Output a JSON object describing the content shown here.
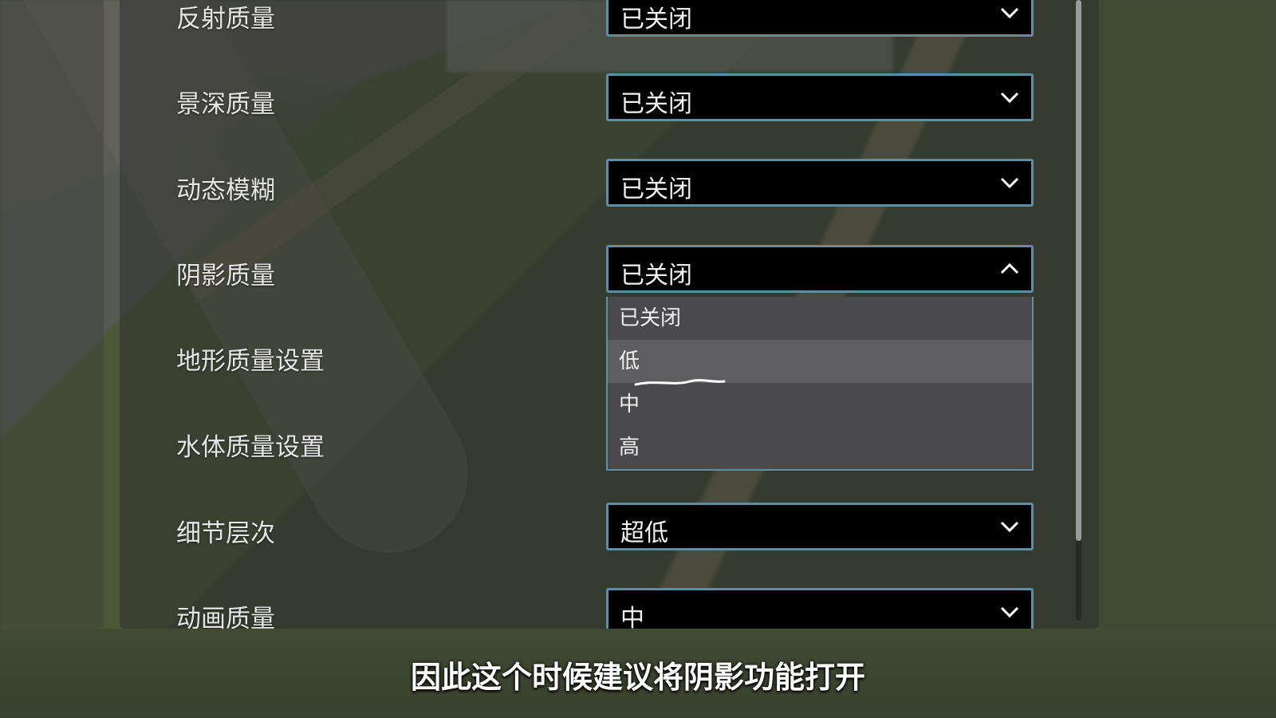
{
  "settings": [
    {
      "label": "反射质量",
      "value": "已关闭",
      "state": "closed"
    },
    {
      "label": "景深质量",
      "value": "已关闭",
      "state": "closed"
    },
    {
      "label": "动态模糊",
      "value": "已关闭",
      "state": "closed"
    },
    {
      "label": "阴影质量",
      "value": "已关闭",
      "state": "open"
    },
    {
      "label": "地形质量设置"
    },
    {
      "label": "水体质量设置"
    },
    {
      "label": "细节层次",
      "value": "超低",
      "state": "closed"
    },
    {
      "label": "动画质量",
      "value": "中",
      "state": "closed"
    }
  ],
  "shadow_dropdown": {
    "options": [
      "已关闭",
      "低",
      "中",
      "高"
    ],
    "hovered": "低"
  },
  "subtitle": "因此这个时候建议将阴影功能打开",
  "colors": {
    "select_border": "#5b8fa8",
    "select_bg": "#000000",
    "dropdown_bg": "#4a4a4c",
    "dropdown_hover": "#5e5e60"
  },
  "icons": {
    "closed": "chevron-down-icon",
    "open": "chevron-up-icon"
  }
}
